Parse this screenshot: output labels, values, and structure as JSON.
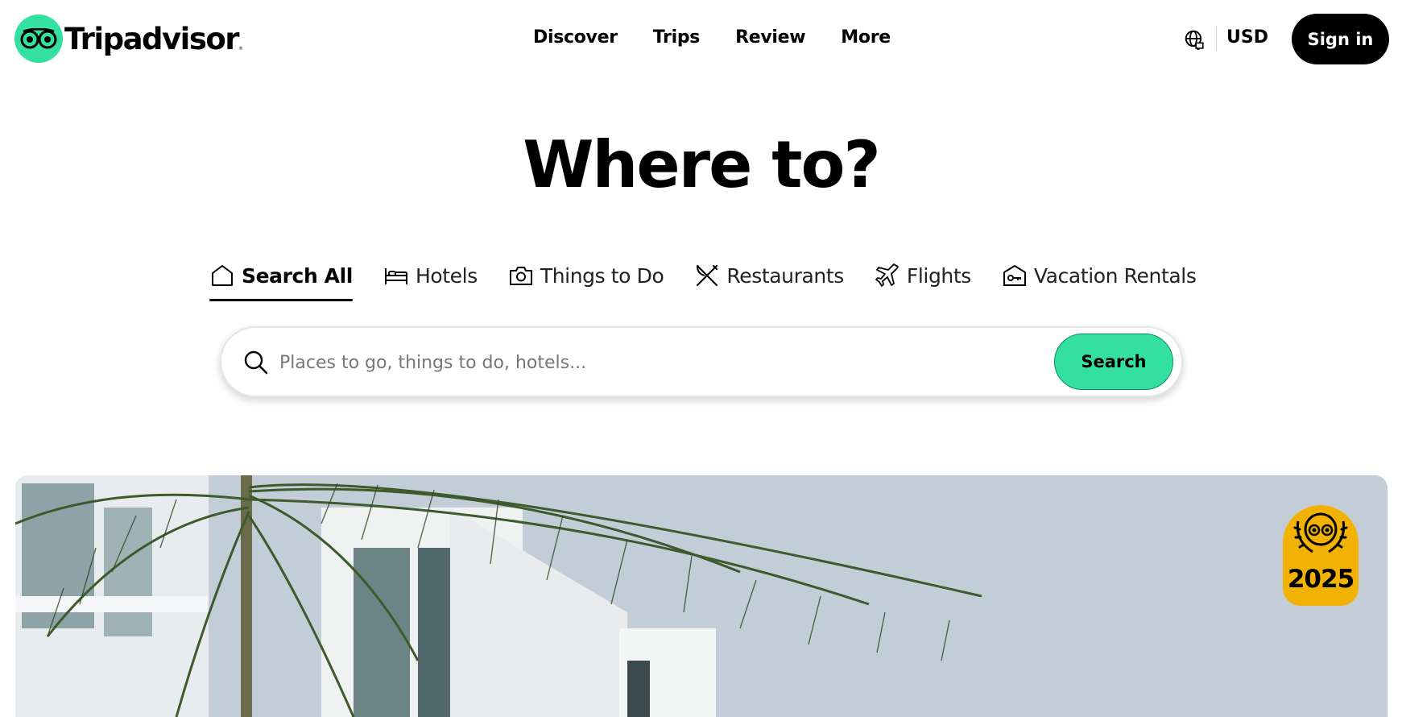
{
  "header": {
    "logo_text": "Tripadvisor",
    "logo_reg": "®",
    "nav": [
      "Discover",
      "Trips",
      "Review",
      "More"
    ],
    "currency": "USD",
    "signin_label": "Sign in"
  },
  "hero": {
    "title": "Where to?",
    "tabs": [
      {
        "label": "Search All",
        "icon": "home-icon",
        "active": true
      },
      {
        "label": "Hotels",
        "icon": "bed-icon",
        "active": false
      },
      {
        "label": "Things to Do",
        "icon": "camera-icon",
        "active": false
      },
      {
        "label": "Restaurants",
        "icon": "utensils-icon",
        "active": false
      },
      {
        "label": "Flights",
        "icon": "plane-icon",
        "active": false
      },
      {
        "label": "Vacation Rentals",
        "icon": "house-key-icon",
        "active": false
      }
    ],
    "search": {
      "placeholder": "Places to go, things to do, hotels...",
      "button_label": "Search"
    }
  },
  "banner": {
    "badge_year": "2025"
  },
  "colors": {
    "brand_green": "#34e0a1",
    "badge_gold": "#f2b203",
    "text": "#000000"
  }
}
